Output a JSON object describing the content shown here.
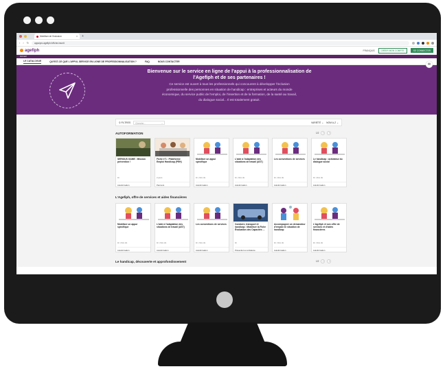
{
  "browser": {
    "tab_title": "Mobiliser de l'inclusion",
    "url": "appuipro.agefiph.fr/fiche-inscrit",
    "tab_close": "×",
    "tab_new": "+"
  },
  "site": {
    "logo": "agefiph",
    "language": "FRANÇAIS",
    "create_account": "CRÉER MON COMPTE",
    "login": "SE CONNECTER",
    "top_strip": "Accueil"
  },
  "nav": [
    "LE CATALOGUE",
    "QU'EST-CE QUE L'APPUI, SERVICE EN LIGNE DE PROFESSIONNALISATION ?",
    "FAQ",
    "NOUS CONTACTER"
  ],
  "hero": {
    "title": "Bienvenue sur le service en ligne de l'appui à la professionnalisation de l'Agefiph et de ses partenaires !",
    "body": "Ce service est ouvert à tous les professionnels qui concourent à développer l'inclusion professionnelle des personnes en situation de handicap : entreprises et acteurs du monde économique, du service public de l'emploi, de l'insertion et de la formation, de la santé au travail, du dialogue social... Il est totalement gratuit."
  },
  "filters": {
    "label": "FILTRES",
    "search_placeholder": "Cherche...",
    "variety": "VARIÉTÉ",
    "sort": "NOM A-Z"
  },
  "sections": [
    {
      "title": "AUTOFORMATION",
      "page": "1/2",
      "cards": [
        {
          "title": "SERIOUS GAME : Mission prévention !",
          "meta": "1h",
          "tag": "Autoformation",
          "thumb": "photo"
        },
        {
          "title": "Fiche n°1 : Plateforme Emploi Handicap (PEH)",
          "meta": "2 jours",
          "tag": "Parcours",
          "thumb": "group"
        },
        {
          "title": "Mobiliser un appui spécifique",
          "meta": "1h  |  Sim tôt",
          "tag": "Autoformation",
          "thumb": "ill"
        },
        {
          "title": "L'aide à l'adaptation des situations de travail (AST)",
          "meta": "1h  |  Sim tôt",
          "tag": "Autoformation",
          "thumb": "ill"
        },
        {
          "title": "Les conventions de services",
          "meta": "1h  |  Sim tôt",
          "tag": "Autoformation",
          "thumb": "ill"
        },
        {
          "title": "Le handicap : activateur du dialogue social",
          "meta": "1h  |  Sim tôt",
          "tag": "Autoformation",
          "thumb": "ill"
        }
      ]
    },
    {
      "title": "L'Agefiph, offre de services et aides financières",
      "page": "",
      "cards": [
        {
          "title": "Mobiliser un appui spécifique",
          "meta": "1h  |  Sim tôt",
          "tag": "Autoformation",
          "thumb": "ill"
        },
        {
          "title": "L'aide à l'adaptation des situations de travail (AST)",
          "meta": "1h  |  Sim tôt",
          "tag": "Autoformation",
          "thumb": "ill"
        },
        {
          "title": "Les conventions de services",
          "meta": "1h  |  Sim tôt",
          "tag": "Autoformation",
          "thumb": "ill"
        },
        {
          "title": "Conduire, transport et handicap : Mobiliser la Fiche Évaluation des Capacités ...",
          "meta": "1h",
          "tag": "Présentiel ou à distance",
          "thumb": "photo2"
        },
        {
          "title": "Accompagner un demandeur d'emploi en situation de handicap",
          "meta": "1h  |  Sim tôt",
          "tag": "Autoformation",
          "thumb": "ill2"
        },
        {
          "title": "L'Agefiph et son offre de services et d'aides financières",
          "meta": "1h  |  Sim tôt",
          "tag": "Autoformation",
          "thumb": "ill"
        }
      ]
    },
    {
      "title": "Le handicap, découverte et approfondissement",
      "page": "1/2",
      "cards": []
    }
  ]
}
